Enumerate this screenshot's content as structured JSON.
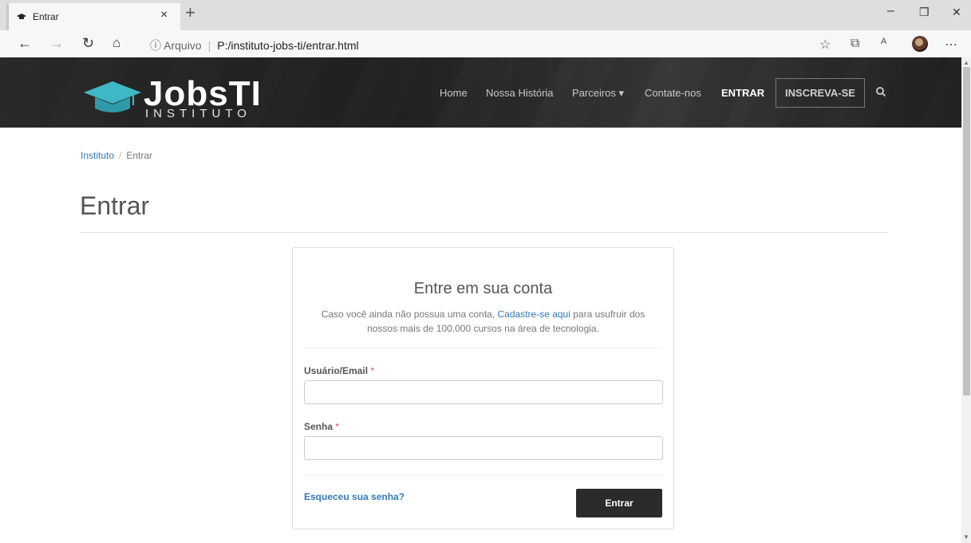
{
  "browser": {
    "tab_title": "Entrar",
    "tab_close": "×",
    "new_tab": "+",
    "address_label": "Arquivo",
    "address_url": "P:/instituto-jobs-ti/entrar.html",
    "win_min": "–",
    "win_max": "❐",
    "win_close": "✕"
  },
  "site": {
    "logo_text": "JobsTI",
    "logo_sub": "INSTITUTO",
    "menu": {
      "home": "Home",
      "historia": "Nossa História",
      "parceiros": "Parceiros ▾",
      "contato": "Contate-nos",
      "entrar": "ENTRAR"
    },
    "signup_button": "INSCREVA-SE"
  },
  "breadcrumb": {
    "root": "Instituto",
    "separator": "/",
    "current": "Entrar"
  },
  "page_title": "Entrar",
  "login": {
    "title": "Entre em sua conta",
    "desc_before": "Caso você ainda não possua uma conta, ",
    "desc_link": "Cadastre-se aqui",
    "desc_after_1": " para usufruir dos",
    "desc_line2": "nossos mais de 100.000 cursos na área de tecnologia.",
    "user_label": "Usuário/Email",
    "user_value": "",
    "password_label": "Senha",
    "password_value": "",
    "required_mark": "*",
    "forgot_link": "Esqueceu sua senha?",
    "submit": "Entrar"
  },
  "colors": {
    "accent": "#337ab7",
    "logo_cap": "#3fb8c6",
    "button_dark": "#2b2b2b",
    "required": "#d9534f"
  }
}
